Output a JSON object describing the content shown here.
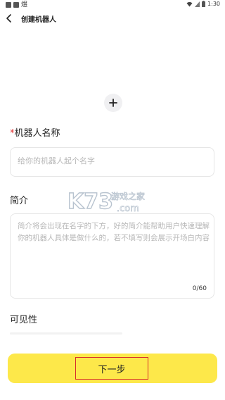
{
  "status_bar": {
    "app_glyph": "煜",
    "time": "1:30"
  },
  "header": {
    "title": "创建机器人"
  },
  "form": {
    "name_label": "机器人名称",
    "required_mark": "*",
    "name_placeholder": "给你的机器人起个名字",
    "name_value": "",
    "intro_label": "简介",
    "intro_placeholder": "简介将会出现在名字的下方，好的简介能帮助用户快速理解你的机器人具体是做什么的，若不填写则会展示开场白内容",
    "intro_counter": "0/60",
    "visibility_label": "可见性"
  },
  "watermark": {
    "logo_text": "K73",
    "site_cn": "游戏之家",
    "site_en": ".com"
  },
  "footer": {
    "next_label": "下一步"
  },
  "colors": {
    "accent_yellow": "#fde84a",
    "required_red": "#e03030",
    "highlight_red": "#d72b2b"
  }
}
